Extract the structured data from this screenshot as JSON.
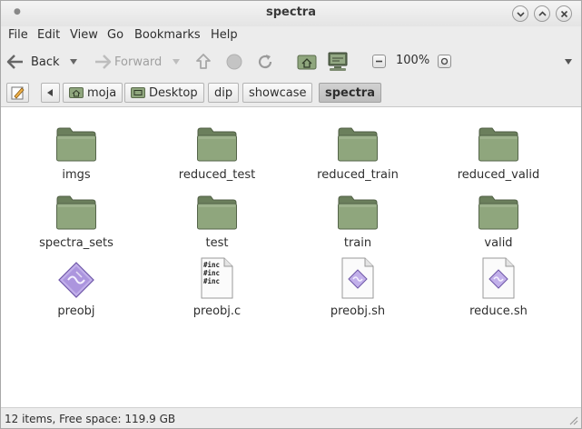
{
  "window": {
    "title": "spectra"
  },
  "menu": [
    "File",
    "Edit",
    "View",
    "Go",
    "Bookmarks",
    "Help"
  ],
  "toolbar": {
    "back_label": "Back",
    "forward_label": "Forward",
    "zoom_level": "100%"
  },
  "breadcrumbs": [
    "moja",
    "Desktop",
    "dip",
    "showcase",
    "spectra"
  ],
  "items": [
    {
      "name": "imgs",
      "type": "folder"
    },
    {
      "name": "reduced_test",
      "type": "folder"
    },
    {
      "name": "reduced_train",
      "type": "folder"
    },
    {
      "name": "reduced_valid",
      "type": "folder"
    },
    {
      "name": "spectra_sets",
      "type": "folder"
    },
    {
      "name": "test",
      "type": "folder"
    },
    {
      "name": "train",
      "type": "folder"
    },
    {
      "name": "valid",
      "type": "folder"
    },
    {
      "name": "preobj",
      "type": "executable"
    },
    {
      "name": "preobj.c",
      "type": "c-source"
    },
    {
      "name": "preobj.sh",
      "type": "script"
    },
    {
      "name": "reduce.sh",
      "type": "script"
    }
  ],
  "c_source_preview": "#inc",
  "status": {
    "text": "12 items, Free space: 119.9 GB"
  },
  "colors": {
    "folder": "#8fa67d",
    "folder_dark": "#6b7f5c",
    "accent": "#9b7fd4"
  }
}
